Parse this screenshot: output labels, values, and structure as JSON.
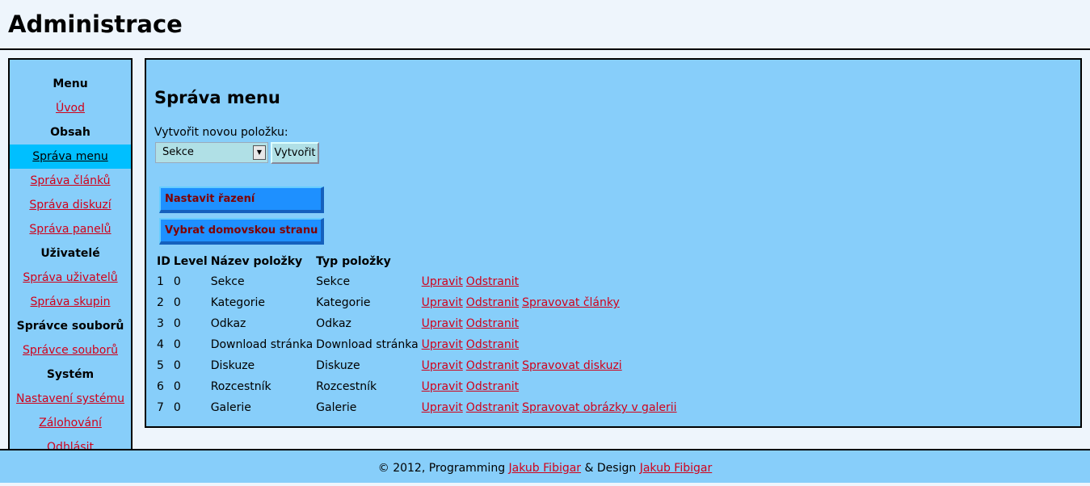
{
  "header": {
    "title": "Administrace"
  },
  "sidebar": {
    "items": [
      {
        "type": "heading",
        "label": "Menu"
      },
      {
        "type": "link",
        "label": "Úvod"
      },
      {
        "type": "heading",
        "label": "Obsah"
      },
      {
        "type": "link",
        "label": "Správa menu",
        "active": true
      },
      {
        "type": "link",
        "label": "Správa článků"
      },
      {
        "type": "link",
        "label": "Správa diskuzí"
      },
      {
        "type": "link",
        "label": "Správa panelů"
      },
      {
        "type": "heading",
        "label": "Uživatelé"
      },
      {
        "type": "link",
        "label": "Správa uživatelů"
      },
      {
        "type": "link",
        "label": "Správa skupin"
      },
      {
        "type": "heading",
        "label": "Správce souborů"
      },
      {
        "type": "link",
        "label": "Správce souborů"
      },
      {
        "type": "heading",
        "label": "Systém"
      },
      {
        "type": "link",
        "label": "Nastavení systému"
      },
      {
        "type": "link",
        "label": "Zálohování"
      },
      {
        "type": "link",
        "label": "Odhlásit"
      }
    ]
  },
  "main": {
    "title": "Správa menu",
    "new_item_label": "Vytvořit novou položku:",
    "type_select": {
      "selected": "Sekce",
      "arrow_icon": "triangle-down-icon"
    },
    "create_label": "Vytvořit",
    "sort_button": "Nastavit řazení",
    "home_button": "Vybrat domovskou stranu",
    "table": {
      "columns": [
        "ID",
        "Level",
        "Název položky",
        "Typ položky"
      ],
      "rows": [
        {
          "id": "1",
          "level": "0",
          "name": "Sekce",
          "type": "Sekce",
          "actions": [
            "Upravit",
            "Odstranit"
          ]
        },
        {
          "id": "2",
          "level": "0",
          "name": "Kategorie",
          "type": "Kategorie",
          "actions": [
            "Upravit",
            "Odstranit",
            "Spravovat články"
          ]
        },
        {
          "id": "3",
          "level": "0",
          "name": "Odkaz",
          "type": "Odkaz",
          "actions": [
            "Upravit",
            "Odstranit"
          ]
        },
        {
          "id": "4",
          "level": "0",
          "name": "Download stránka",
          "type": "Download stránka",
          "actions": [
            "Upravit",
            "Odstranit"
          ]
        },
        {
          "id": "5",
          "level": "0",
          "name": "Diskuze",
          "type": "Diskuze",
          "actions": [
            "Upravit",
            "Odstranit",
            "Spravovat diskuzi"
          ]
        },
        {
          "id": "6",
          "level": "0",
          "name": "Rozcestník",
          "type": "Rozcestník",
          "actions": [
            "Upravit",
            "Odstranit"
          ]
        },
        {
          "id": "7",
          "level": "0",
          "name": "Galerie",
          "type": "Galerie",
          "actions": [
            "Upravit",
            "Odstranit",
            "Spravovat obrázky v galerii"
          ]
        }
      ]
    }
  },
  "footer": {
    "copyright": "© 2012, Programming",
    "programmer": "Jakub Fibigar",
    "separator": "& Design",
    "designer": "Jakub Fibigar"
  },
  "colors": {
    "page_bg": "#eef5fc",
    "panel_bg": "#87cefa",
    "active_item_bg": "#00bfff",
    "link": "#d0021b",
    "button_bg": "#1e90ff",
    "button_text": "#800000"
  }
}
